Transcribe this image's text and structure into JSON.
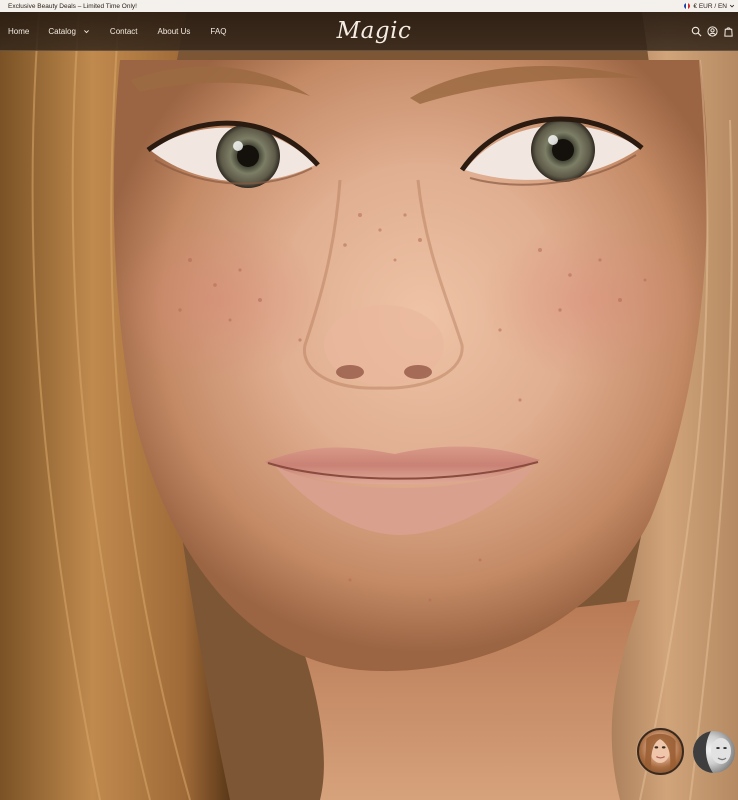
{
  "announcement": {
    "text": "Exclusive Beauty Deals – Limited Time Only!",
    "locale_label": "€ EUR / EN"
  },
  "header": {
    "logo_text": "Magic",
    "nav": [
      {
        "label": "Home"
      },
      {
        "label": "Catalog"
      },
      {
        "label": "Contact"
      },
      {
        "label": "About Us"
      },
      {
        "label": "FAQ"
      }
    ],
    "icons": [
      "search-icon",
      "account-icon",
      "cart-icon"
    ]
  },
  "hero": {
    "image": "close-up portrait of freckled young woman with long blonde hair"
  },
  "stories": [
    {
      "image": "woman portrait thumbnail"
    },
    {
      "image": "grayscale woman portrait thumbnail"
    }
  ],
  "colors": {
    "announcement_bg": "#f4f1ec",
    "header_bg": "#2f2218",
    "nav_text": "#f3ebe2"
  }
}
